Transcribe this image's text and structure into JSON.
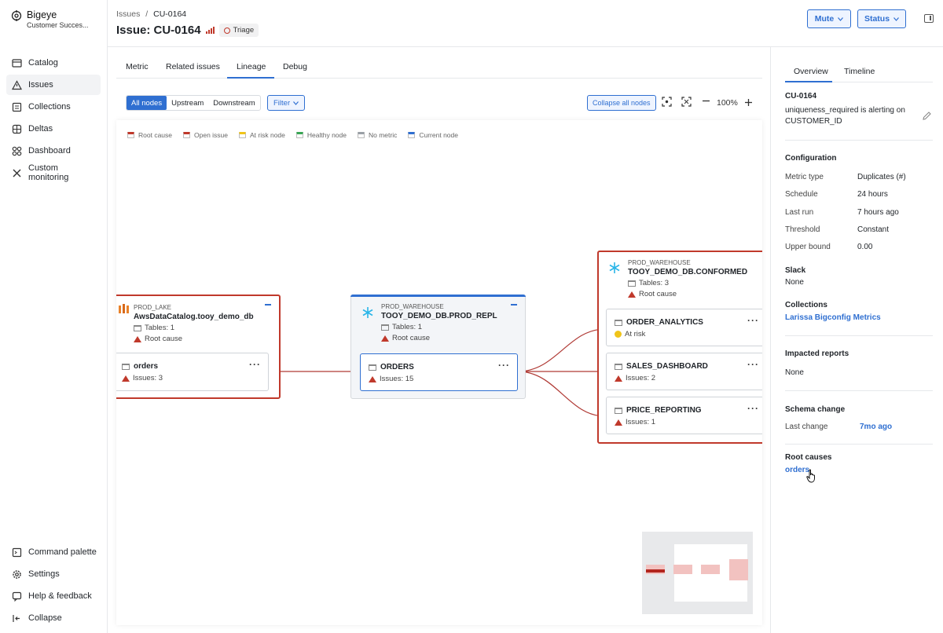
{
  "sidebar": {
    "brand": {
      "name": "Bigeye",
      "workspace": "Customer Succes..."
    },
    "items": [
      {
        "label": "Catalog",
        "icon": "catalog-icon"
      },
      {
        "label": "Issues",
        "icon": "warning-triangle-icon",
        "active": true
      },
      {
        "label": "Collections",
        "icon": "collections-icon"
      },
      {
        "label": "Deltas",
        "icon": "deltas-icon"
      },
      {
        "label": "Dashboard",
        "icon": "dashboard-icon"
      },
      {
        "label": "Custom monitoring",
        "icon": "tools-icon"
      }
    ],
    "bottom": [
      {
        "label": "Command palette",
        "icon": "terminal-icon"
      },
      {
        "label": "Settings",
        "icon": "gear-icon"
      },
      {
        "label": "Help & feedback",
        "icon": "help-icon"
      },
      {
        "label": "Collapse",
        "icon": "collapse-icon"
      }
    ]
  },
  "header": {
    "breadcrumb_root": "Issues",
    "breadcrumb_sep": "/",
    "breadcrumb_current": "CU-0164",
    "title": "Issue: CU-0164",
    "status_badge": "Triage",
    "mute_label": "Mute",
    "status_label": "Status"
  },
  "tabs": [
    "Metric",
    "Related issues",
    "Lineage",
    "Debug"
  ],
  "active_tab": "Lineage",
  "toolbar": {
    "direction": [
      "All nodes",
      "Upstream",
      "Downstream"
    ],
    "filter_label": "Filter",
    "collapse_label": "Collapse all nodes",
    "zoom": "100%"
  },
  "legend": [
    {
      "label": "Root cause",
      "color": "#c0392b"
    },
    {
      "label": "Open issue",
      "color": "#c0392b"
    },
    {
      "label": "At risk node",
      "color": "#f0c419"
    },
    {
      "label": "Healthy node",
      "color": "#3aa655"
    },
    {
      "label": "No metric",
      "color": "#9aa0a6"
    },
    {
      "label": "Current node",
      "color": "#2f6fd1"
    }
  ],
  "nodes": {
    "lake": {
      "db": "PROD_LAKE",
      "name": "AwsDataCatalog.tooy_demo_db",
      "tables": "Tables: 1",
      "status": "Root cause",
      "child": {
        "name": "orders",
        "issues": "Issues: 3"
      }
    },
    "repl": {
      "db": "PROD_WAREHOUSE",
      "name": "TOOY_DEMO_DB.PROD_REPL",
      "tables": "Tables: 1",
      "status": "Root cause",
      "child": {
        "name": "ORDERS",
        "issues": "Issues: 15"
      }
    },
    "conformed": {
      "db": "PROD_WAREHOUSE",
      "name": "TOOY_DEMO_DB.CONFORMED",
      "tables": "Tables: 3",
      "status": "Root cause",
      "children": [
        {
          "name": "ORDER_ANALYTICS",
          "status": "At risk"
        },
        {
          "name": "SALES_DASHBOARD",
          "status": "Issues: 2"
        },
        {
          "name": "PRICE_REPORTING",
          "status": "Issues: 1"
        }
      ]
    }
  },
  "panel": {
    "tabs": [
      "Overview",
      "Timeline"
    ],
    "issue_id": "CU-0164",
    "description": "uniqueness_required is alerting on CUSTOMER_ID",
    "configuration_title": "Configuration",
    "config": [
      {
        "label": "Metric type",
        "value": "Duplicates (#)"
      },
      {
        "label": "Schedule",
        "value": "24 hours"
      },
      {
        "label": "Last run",
        "value": "7 hours ago"
      },
      {
        "label": "Threshold",
        "value": "Constant"
      },
      {
        "label": "Upper bound",
        "value": "0.00"
      }
    ],
    "slack_title": "Slack",
    "slack_value": "None",
    "collections_title": "Collections",
    "collections_value": "Larissa Bigconfig Metrics",
    "reports_title": "Impacted reports",
    "reports_value": "None",
    "schema_title": "Schema change",
    "schema_label": "Last change",
    "schema_value": "7mo ago",
    "root_title": "Root causes",
    "root_value": "orders"
  }
}
